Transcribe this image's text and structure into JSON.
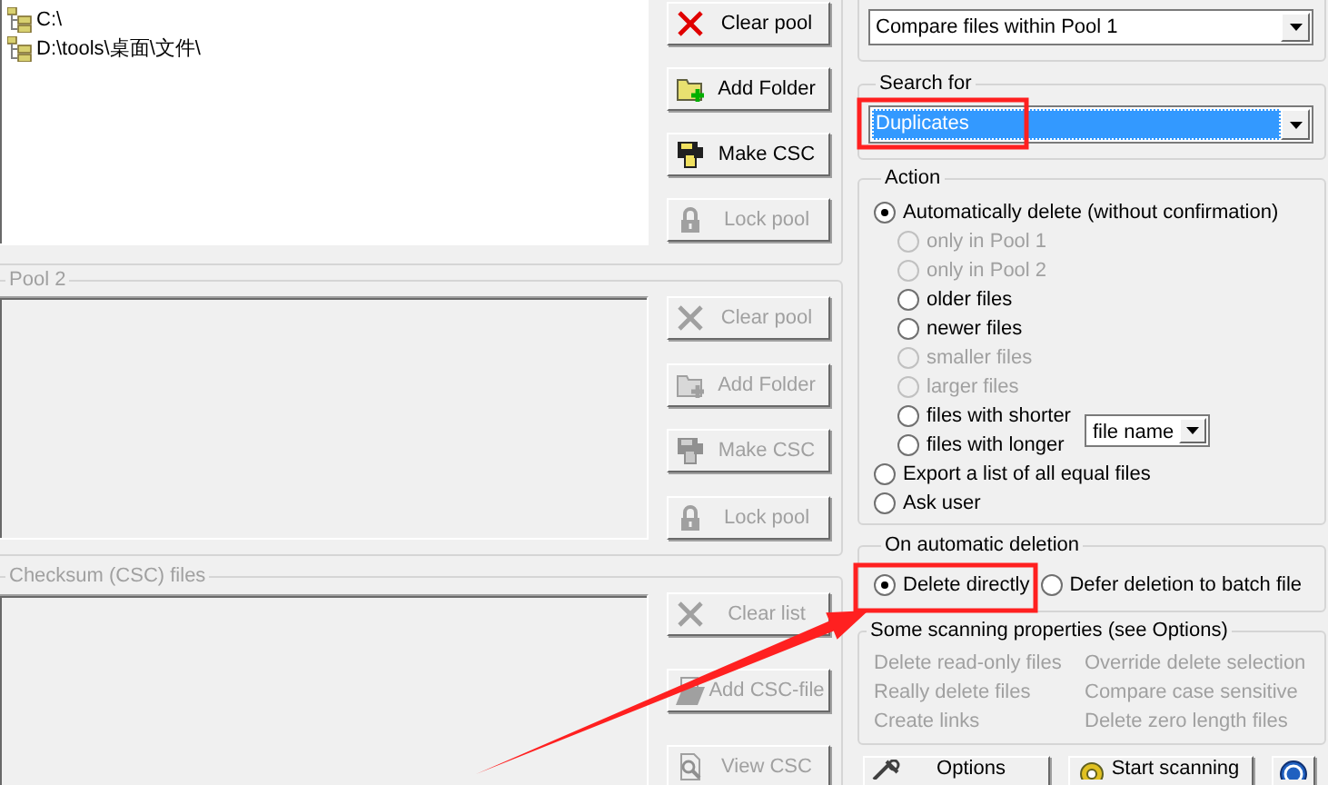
{
  "pool1": {
    "items": [
      {
        "label": "C:\\"
      },
      {
        "label": "D:\\tools\\桌面\\文件\\"
      }
    ],
    "buttons": [
      {
        "label": "Clear pool",
        "kind": "clear",
        "disabled": false
      },
      {
        "label": "Add Folder",
        "kind": "add-folder",
        "disabled": false
      },
      {
        "label": "Make CSC",
        "kind": "make-csc",
        "disabled": false
      },
      {
        "label": "Lock pool",
        "kind": "lock",
        "disabled": true
      }
    ]
  },
  "pool2": {
    "title": "Pool 2",
    "disabled": true,
    "buttons": [
      {
        "label": "Clear pool",
        "kind": "clear",
        "disabled": true
      },
      {
        "label": "Add Folder",
        "kind": "add-folder",
        "disabled": true
      },
      {
        "label": "Make CSC",
        "kind": "make-csc",
        "disabled": true
      },
      {
        "label": "Lock pool",
        "kind": "lock",
        "disabled": true
      }
    ]
  },
  "checksum": {
    "title": "Checksum (CSC) files",
    "disabled": true,
    "buttons": [
      {
        "label": "Clear list",
        "kind": "clear",
        "disabled": true
      },
      {
        "label": "Add CSC-file",
        "kind": "add-csc",
        "disabled": true
      },
      {
        "label": "View CSC",
        "kind": "view-csc",
        "disabled": true
      }
    ]
  },
  "compare": {
    "value": "Compare files within Pool 1",
    "focused": false
  },
  "search_for": {
    "title": "Search for",
    "value": "Duplicates",
    "focused": true
  },
  "action": {
    "title": "Action",
    "options": [
      {
        "label": "Automatically delete (without confirmation)",
        "selected": true,
        "disabled": false,
        "children": [
          {
            "label": "only in Pool 1",
            "selected": false,
            "disabled": true
          },
          {
            "label": "only in Pool 2",
            "selected": false,
            "disabled": true
          },
          {
            "label": "older files",
            "selected": false,
            "disabled": false
          },
          {
            "label": "newer files",
            "selected": false,
            "disabled": false
          },
          {
            "label": "smaller files",
            "selected": false,
            "disabled": true
          },
          {
            "label": "larger files",
            "selected": false,
            "disabled": true
          },
          {
            "label": "files with shorter",
            "selected": false,
            "disabled": false,
            "kind": "length"
          },
          {
            "label": "files with longer",
            "selected": false,
            "disabled": false,
            "kind": "length"
          }
        ]
      },
      {
        "label": "Export a list of all equal files",
        "selected": false,
        "disabled": false
      },
      {
        "label": "Ask user",
        "selected": false,
        "disabled": false
      }
    ],
    "length_by": {
      "value": "file name"
    }
  },
  "on_automatic_deletion": {
    "title": "On automatic deletion",
    "options": [
      {
        "label": "Delete directly",
        "selected": true,
        "disabled": false
      },
      {
        "label": "Defer deletion to batch file",
        "selected": false,
        "disabled": false
      }
    ]
  },
  "scanning_properties": {
    "title": "Some scanning properties (see Options)",
    "disabled": true,
    "items": [
      "Delete read-only files",
      "Override delete selection",
      "Really delete files",
      "Compare case sensitive",
      "Create links",
      "Delete zero length files"
    ]
  },
  "footer_buttons": [
    {
      "label": "Options",
      "kind": "options"
    },
    {
      "label": "Start scanning",
      "kind": "start"
    },
    {
      "kind": "help"
    }
  ]
}
